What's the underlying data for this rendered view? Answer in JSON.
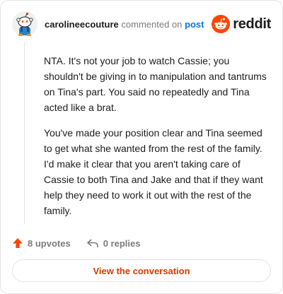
{
  "header": {
    "username": "carolineecouture",
    "verb": "commented on",
    "post_link": "post",
    "brand_name": "reddit",
    "brand_color": "#ff4500"
  },
  "comment": {
    "paragraphs": [
      "NTA. It's not your job to watch Cassie; you shouldn't be giving in to manipulation and tantrums on Tina's part. You said no repeatedly and Tina acted like a brat.",
      "You've made your position clear and Tina seemed to get what she wanted from the rest of the family. I'd make it clear that you aren't taking care of Cassie to both Tina and Jake and that if they want help they need to work it out with the rest of the family."
    ]
  },
  "stats": {
    "upvotes_label": "8 upvotes",
    "replies_label": "0 replies",
    "upvote_icon": "upvote-arrow-icon",
    "reply_icon": "reply-arrow-icon",
    "upvote_color": "#ff4500"
  },
  "cta": {
    "label": "View the conversation",
    "color": "#d93a00"
  }
}
